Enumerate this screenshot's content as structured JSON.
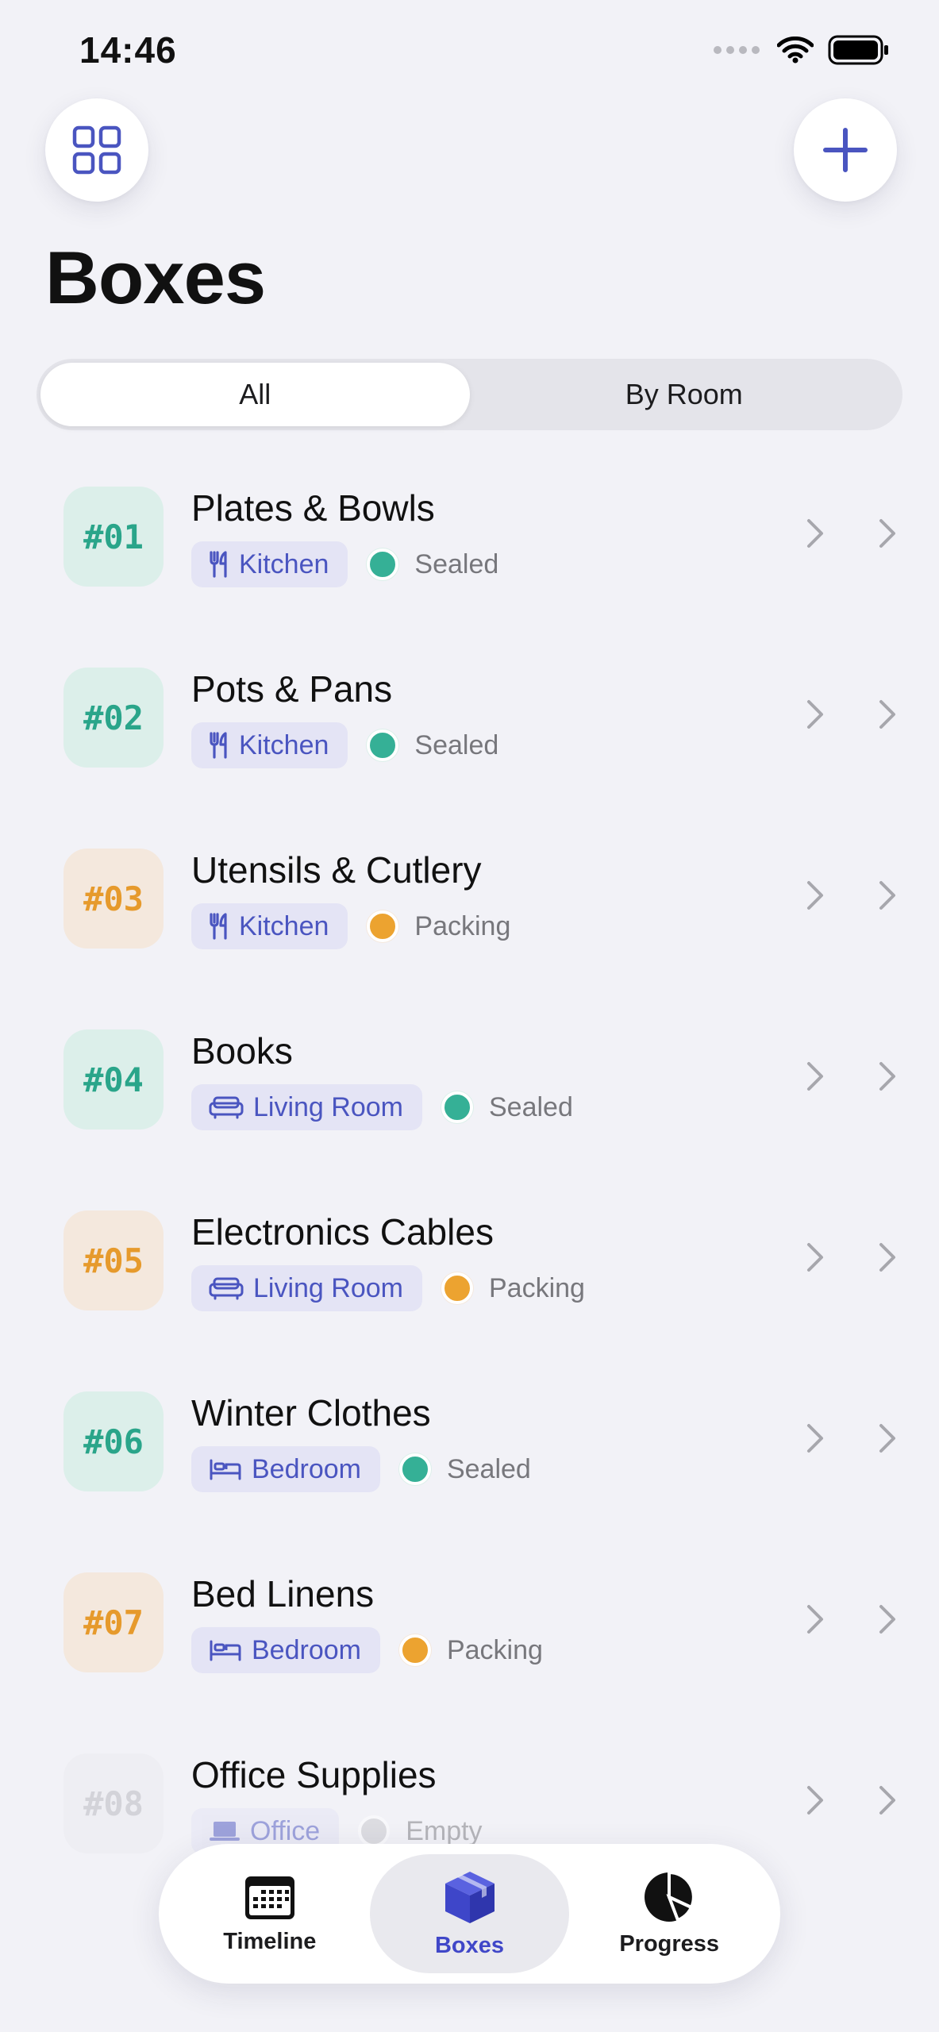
{
  "status_bar": {
    "time": "14:46"
  },
  "header": {
    "title": "Boxes"
  },
  "segments": [
    {
      "label": "All",
      "active": true
    },
    {
      "label": "By Room",
      "active": false
    }
  ],
  "colors": {
    "accent": "#4047c8",
    "sealed": "#35b096",
    "packing": "#eca330",
    "empty": "#c8c8cd"
  },
  "boxes": [
    {
      "number": "#01",
      "name": "Plates & Bowls",
      "room": "Kitchen",
      "room_icon": "utensils-icon",
      "status": "Sealed",
      "state": "sealed"
    },
    {
      "number": "#02",
      "name": "Pots & Pans",
      "room": "Kitchen",
      "room_icon": "utensils-icon",
      "status": "Sealed",
      "state": "sealed"
    },
    {
      "number": "#03",
      "name": "Utensils & Cutlery",
      "room": "Kitchen",
      "room_icon": "utensils-icon",
      "status": "Packing",
      "state": "packing"
    },
    {
      "number": "#04",
      "name": "Books",
      "room": "Living Room",
      "room_icon": "sofa-icon",
      "status": "Sealed",
      "state": "sealed"
    },
    {
      "number": "#05",
      "name": "Electronics Cables",
      "room": "Living Room",
      "room_icon": "sofa-icon",
      "status": "Packing",
      "state": "packing"
    },
    {
      "number": "#06",
      "name": "Winter Clothes",
      "room": "Bedroom",
      "room_icon": "bed-icon",
      "status": "Sealed",
      "state": "sealed"
    },
    {
      "number": "#07",
      "name": "Bed Linens",
      "room": "Bedroom",
      "room_icon": "bed-icon",
      "status": "Packing",
      "state": "packing"
    },
    {
      "number": "#08",
      "name": "Office Supplies",
      "room": "Office",
      "room_icon": "laptop-icon",
      "status": "Empty",
      "state": "empty"
    }
  ],
  "tabbar": {
    "tabs": [
      {
        "label": "Timeline",
        "icon": "calendar-icon",
        "active": false
      },
      {
        "label": "Boxes",
        "icon": "box-icon",
        "active": true
      },
      {
        "label": "Progress",
        "icon": "pie-chart-icon",
        "active": false
      }
    ]
  }
}
